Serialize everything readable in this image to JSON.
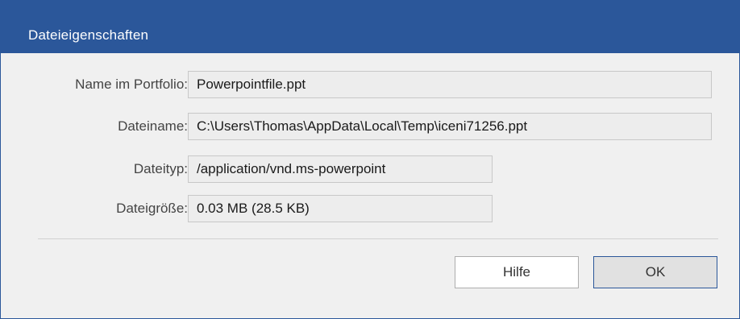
{
  "window": {
    "title": "Dateieigenschaften",
    "accent_color": "#2b579a"
  },
  "properties": [
    {
      "label": "Name im Portfolio:",
      "value": "Powerpointfile.ppt"
    },
    {
      "label": "Dateiname:",
      "value": "C:\\Users\\Thomas\\AppData\\Local\\Temp\\iceni71256.ppt"
    },
    {
      "label": "Dateityp:",
      "value": "/application/vnd.ms-powerpoint"
    },
    {
      "label": "Dateigröße:",
      "value": "0.03 MB (28.5 KB)"
    }
  ],
  "buttons": {
    "help_label": "Hilfe",
    "ok_label": "OK"
  }
}
